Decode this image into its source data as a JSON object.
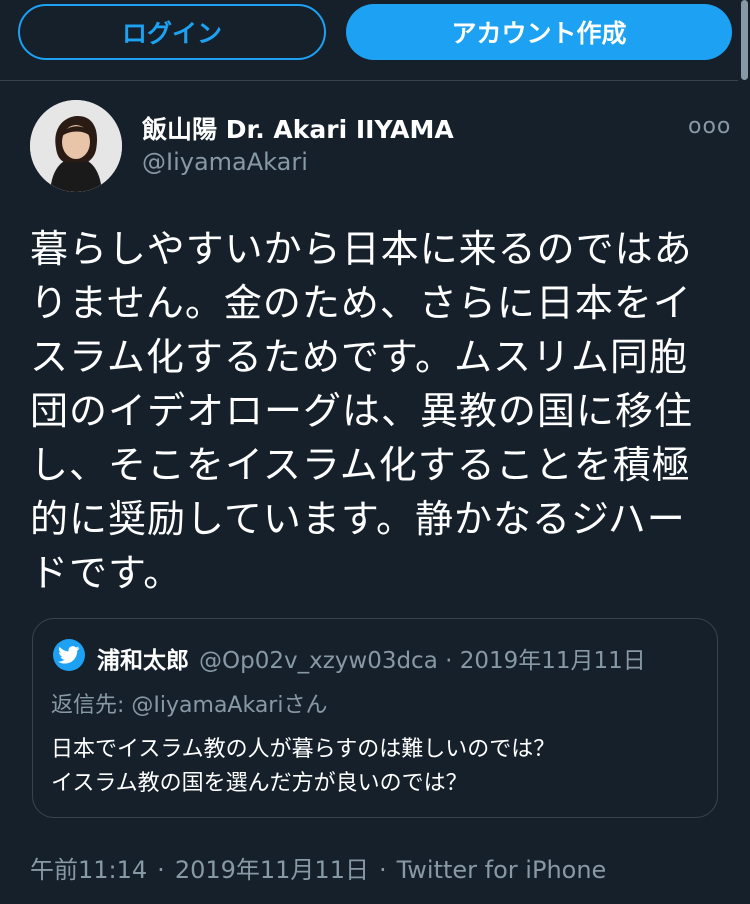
{
  "header": {
    "login_label": "ログイン",
    "signup_label": "アカウント作成"
  },
  "tweet": {
    "author_name": "飯山陽 Dr. Akari IIYAMA",
    "author_handle": "@IiyamaAkari",
    "more_label": "ooo",
    "text_lines": [
      "暮らしやすいから日本に来るのではあ",
      "りません。金のため、さらに日本をイ",
      "スラム化するためです。ムスリム同胞",
      "団のイデオローグは、異教の国に移住",
      "し、そこをイスラム化することを積極",
      "的に奨励しています。静かなるジハー",
      "ドです。"
    ],
    "time": "午前11:14",
    "date": "2019年11月11日",
    "separator": "·",
    "source": "Twitter for iPhone"
  },
  "quoted": {
    "author_name": "浦和太郎",
    "author_handle": "@Op02v_xzyw03dca",
    "separator": "·",
    "date": "2019年11月11日",
    "reply_prefix": "返信先: ",
    "reply_to": "@IiyamaAkari",
    "reply_suffix": "さん",
    "text_lines": [
      "日本でイスラム教の人が暮らすのは難しいのでは？",
      "イスラム教の国を選んだ方が良いのでは？"
    ]
  },
  "colors": {
    "background": "#15202b",
    "accent": "#1da1f2",
    "muted": "#8899a6",
    "border": "#38444d"
  }
}
